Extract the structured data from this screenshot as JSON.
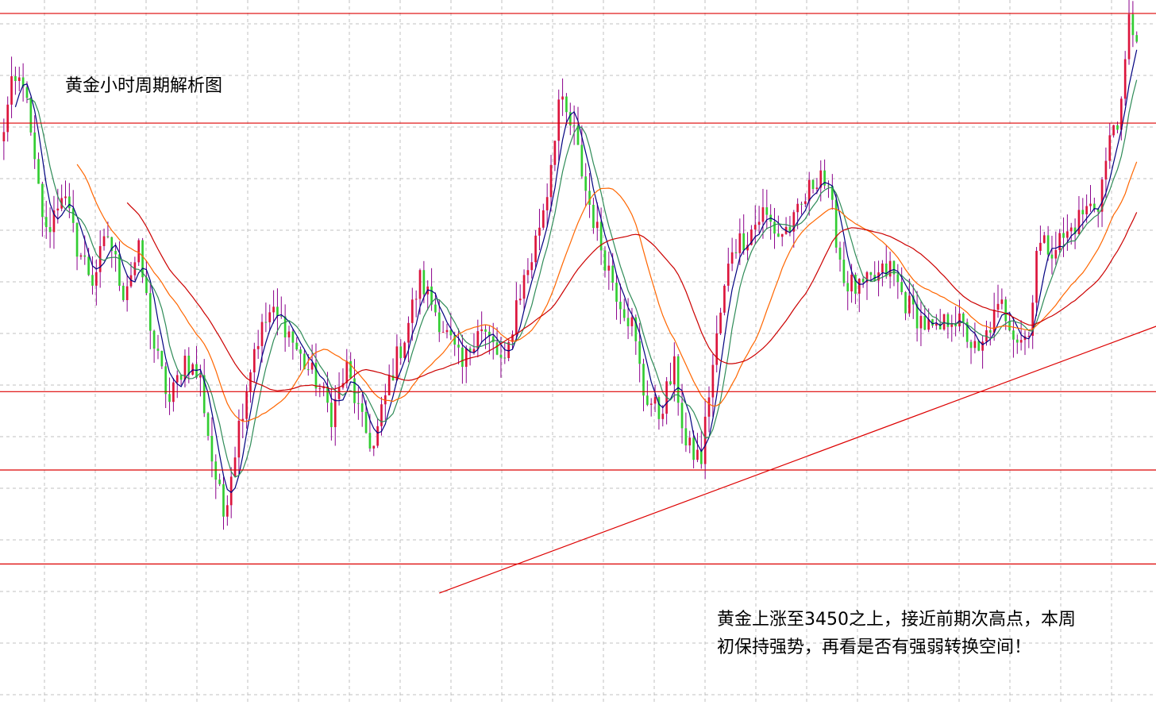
{
  "colors": {
    "background": "#ffffff",
    "grid": "#c0c0c0",
    "up": "#dc143c",
    "down": "#32cd32",
    "wick": "#8b008b",
    "level_line": "#dd0000",
    "ma_fast": "#000080",
    "ma_mid": "#2e8b57",
    "ma_slow": "#ff6600",
    "ma_long": "#cc0000"
  },
  "annotation": {
    "title": "黄金小时周期解析图",
    "note_line1": "黄金上涨至3450之上，接近前期次高点，本周",
    "note_line2": "初保持强势，再看是否有强弱转换空间！"
  },
  "chart_data": {
    "type": "candlestick",
    "title": "黄金小时周期解析图",
    "xlabel": "",
    "ylabel": "",
    "grid": true,
    "legend": "none",
    "ylim": [
      3140,
      3455
    ],
    "xlim": [
      0,
      300
    ],
    "horizontal_levels": [
      3449,
      3400,
      3280,
      3245,
      3203
    ],
    "trendline": {
      "x": [
        114,
        320
      ],
      "y": [
        3190,
        3322
      ]
    },
    "anchors": [
      [
        0,
        3390
      ],
      [
        3,
        3415
      ],
      [
        6,
        3420
      ],
      [
        9,
        3380
      ],
      [
        12,
        3350
      ],
      [
        16,
        3370
      ],
      [
        20,
        3345
      ],
      [
        24,
        3330
      ],
      [
        28,
        3350
      ],
      [
        32,
        3325
      ],
      [
        36,
        3342
      ],
      [
        40,
        3300
      ],
      [
        44,
        3275
      ],
      [
        48,
        3295
      ],
      [
        52,
        3285
      ],
      [
        55,
        3250
      ],
      [
        58,
        3225
      ],
      [
        62,
        3265
      ],
      [
        66,
        3300
      ],
      [
        70,
        3315
      ],
      [
        74,
        3310
      ],
      [
        78,
        3295
      ],
      [
        82,
        3285
      ],
      [
        86,
        3270
      ],
      [
        90,
        3290
      ],
      [
        94,
        3265
      ],
      [
        97,
        3255
      ],
      [
        101,
        3285
      ],
      [
        105,
        3305
      ],
      [
        109,
        3330
      ],
      [
        112,
        3320
      ],
      [
        116,
        3305
      ],
      [
        120,
        3290
      ],
      [
        124,
        3310
      ],
      [
        128,
        3300
      ],
      [
        131,
        3290
      ],
      [
        134,
        3320
      ],
      [
        138,
        3340
      ],
      [
        142,
        3370
      ],
      [
        145,
        3410
      ],
      [
        149,
        3395
      ],
      [
        152,
        3370
      ],
      [
        156,
        3345
      ],
      [
        160,
        3325
      ],
      [
        164,
        3310
      ],
      [
        167,
        3280
      ],
      [
        171,
        3270
      ],
      [
        175,
        3290
      ],
      [
        178,
        3255
      ],
      [
        182,
        3250
      ],
      [
        184,
        3280
      ],
      [
        187,
        3315
      ],
      [
        190,
        3345
      ],
      [
        194,
        3350
      ],
      [
        198,
        3360
      ],
      [
        202,
        3350
      ],
      [
        206,
        3355
      ],
      [
        210,
        3370
      ],
      [
        213,
        3380
      ],
      [
        216,
        3360
      ],
      [
        219,
        3330
      ],
      [
        223,
        3325
      ],
      [
        227,
        3330
      ],
      [
        231,
        3335
      ],
      [
        235,
        3320
      ],
      [
        239,
        3312
      ],
      [
        243,
        3305
      ],
      [
        247,
        3315
      ],
      [
        251,
        3305
      ],
      [
        254,
        3295
      ],
      [
        257,
        3310
      ],
      [
        260,
        3318
      ],
      [
        264,
        3305
      ],
      [
        267,
        3305
      ],
      [
        269,
        3345
      ],
      [
        273,
        3345
      ],
      [
        277,
        3350
      ],
      [
        281,
        3360
      ],
      [
        285,
        3365
      ],
      [
        289,
        3400
      ],
      [
        291,
        3405
      ],
      [
        293,
        3445
      ],
      [
        295,
        3440
      ]
    ],
    "moving_averages": [
      {
        "label": "ma-fast",
        "period": 5
      },
      {
        "label": "ma-mid",
        "period": 8
      },
      {
        "label": "ma-slow",
        "period": 21
      },
      {
        "label": "ma-long",
        "period": 34
      }
    ]
  }
}
